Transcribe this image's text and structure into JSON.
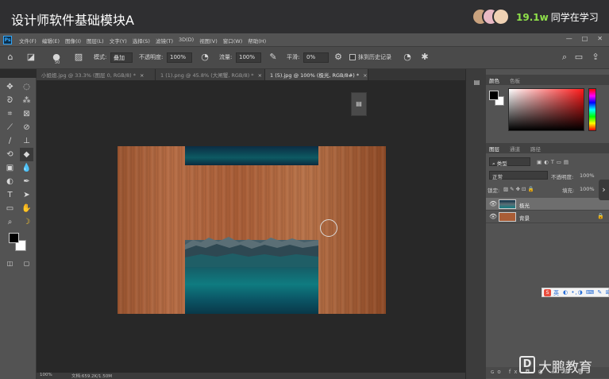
{
  "course": {
    "title": "设计师软件基础模块A",
    "viewer_count": "19.1w",
    "viewer_label": "同学在学习"
  },
  "app": {
    "logo": "Ps",
    "menu": [
      "文件(F)",
      "编辑(E)",
      "图像(I)",
      "图层(L)",
      "文字(Y)",
      "选择(S)",
      "滤镜(T)",
      "3D(D)",
      "视图(V)",
      "窗口(W)",
      "帮助(H)"
    ],
    "window_controls": [
      "—",
      "□",
      "✕"
    ]
  },
  "options": {
    "brush_size": "50",
    "mode_label": "模式:",
    "mode_value": "叠加",
    "opacity_label": "不透明度:",
    "opacity_value": "100%",
    "flow_label": "流量:",
    "flow_value": "100%",
    "smoothing_label": "平滑:",
    "smoothing_value": "0%",
    "erase_history_label": "抹到历史记录"
  },
  "tabs": [
    {
      "label": "小姐姐.jpg @ 33.3% (图层 0, RGB/8) *",
      "active": false
    },
    {
      "label": "1 (1).png @ 45.8% (大闸蟹, RGB/8) *",
      "active": false
    },
    {
      "label": "1 (5).jpg @ 100% (极光, RGB/8#) *",
      "active": true
    }
  ],
  "status": {
    "zoom": "100%",
    "doc_info": "文档:659.2K/1.50M"
  },
  "panels": {
    "color_tabs": [
      "颜色",
      "色板"
    ],
    "layer_tabs": [
      "图层",
      "通道",
      "路径"
    ],
    "filter_kind": "类型",
    "blend_mode": "正常",
    "opacity_label": "不透明度:",
    "opacity_value": "100%",
    "lock_label": "锁定:",
    "fill_label": "填充:",
    "fill_value": "100%",
    "layers": [
      {
        "name": "极光",
        "selected": true,
        "locked": false
      },
      {
        "name": "背景",
        "selected": false,
        "locked": true
      }
    ],
    "footer_icons": "ɢᴏ  fx  ◘  ◑  ▭  ⊞  🗑"
  },
  "ime": {
    "badge": "S",
    "lang": "英",
    "rest": "◐ •,◑ ⌨ ✎ ⊞"
  },
  "watermark": {
    "logo": "D",
    "text": "大鹏教育"
  },
  "colors": {
    "accent_green": "#8fe04a",
    "ps_blue": "#31a8ff",
    "wood": "#a95d36",
    "aurora_teal": "#0f7b80"
  }
}
